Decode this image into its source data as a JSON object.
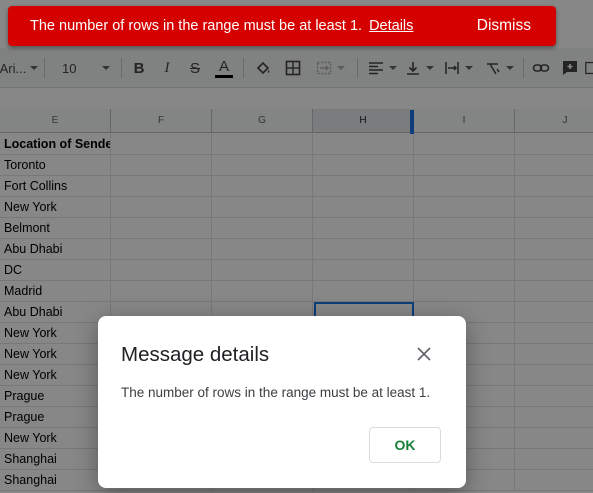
{
  "snackbar": {
    "message": "The number of rows in the range must be at least 1.",
    "link": "Details",
    "dismiss": "Dismiss"
  },
  "app_peek": "s",
  "toolbar": {
    "font": "Ari...",
    "font_size": "10",
    "text_color_bar": "#000000"
  },
  "columns": [
    "E",
    "F",
    "G",
    "H",
    "I",
    "J"
  ],
  "selected_column": "H",
  "rows": [
    "Location of Sender",
    "Toronto",
    "Fort Collins",
    "New York",
    "Belmont",
    "Abu Dhabi",
    "DC",
    "Madrid",
    "Abu Dhabi",
    "New York",
    "New York",
    "New York",
    "Prague",
    "Prague",
    "New York",
    "Shanghai",
    "Shanghai"
  ],
  "dialog": {
    "title": "Message details",
    "body": "The number of rows in the range must be at least 1.",
    "ok": "OK"
  },
  "colors": {
    "error": "#d50000",
    "accent": "#1a73e8",
    "ok_text": "#188038"
  }
}
